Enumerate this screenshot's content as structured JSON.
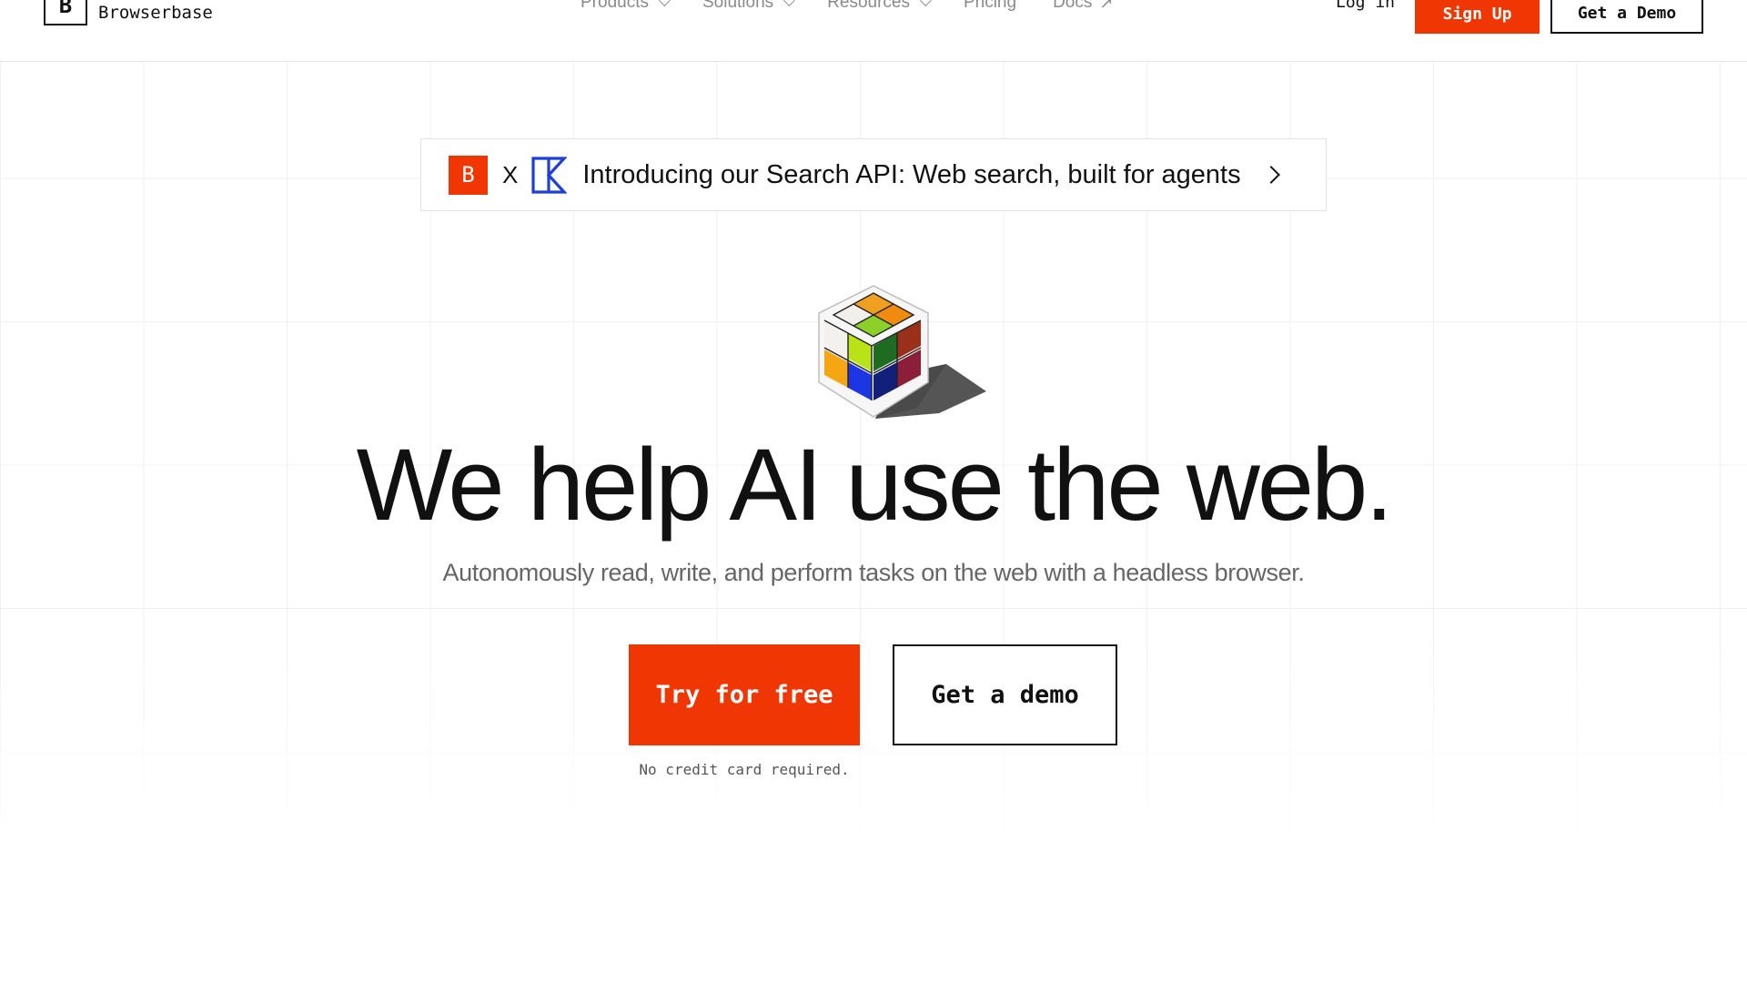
{
  "brand": {
    "logo_letter": "B",
    "name": "Browserbase",
    "accent_color": "#f03603"
  },
  "nav": {
    "items": [
      {
        "label": "Products",
        "icon": "chevron-down-icon"
      },
      {
        "label": "Solutions",
        "icon": "chevron-down-icon"
      },
      {
        "label": "Resources",
        "icon": "chevron-down-icon"
      },
      {
        "label": "Pricing"
      },
      {
        "label": "Docs",
        "icon": "external-arrow-icon"
      }
    ],
    "login_label": "Log in",
    "signup_label": "Sign Up",
    "demo_label": "Get a Demo"
  },
  "announcement": {
    "badge_letter": "B",
    "separator": "X",
    "partner_logo_icon": "exa-logo-icon",
    "text": "Introducing our Search API: Web search, built for agents"
  },
  "hero": {
    "illustration_icon": "rubik-cube-icon",
    "title": "We help AI use the web.",
    "subtitle": "Autonomously read, write, and perform tasks on the web with a headless browser.",
    "primary_cta": "Try for free",
    "secondary_cta": "Get a demo",
    "note": "No credit card required."
  }
}
